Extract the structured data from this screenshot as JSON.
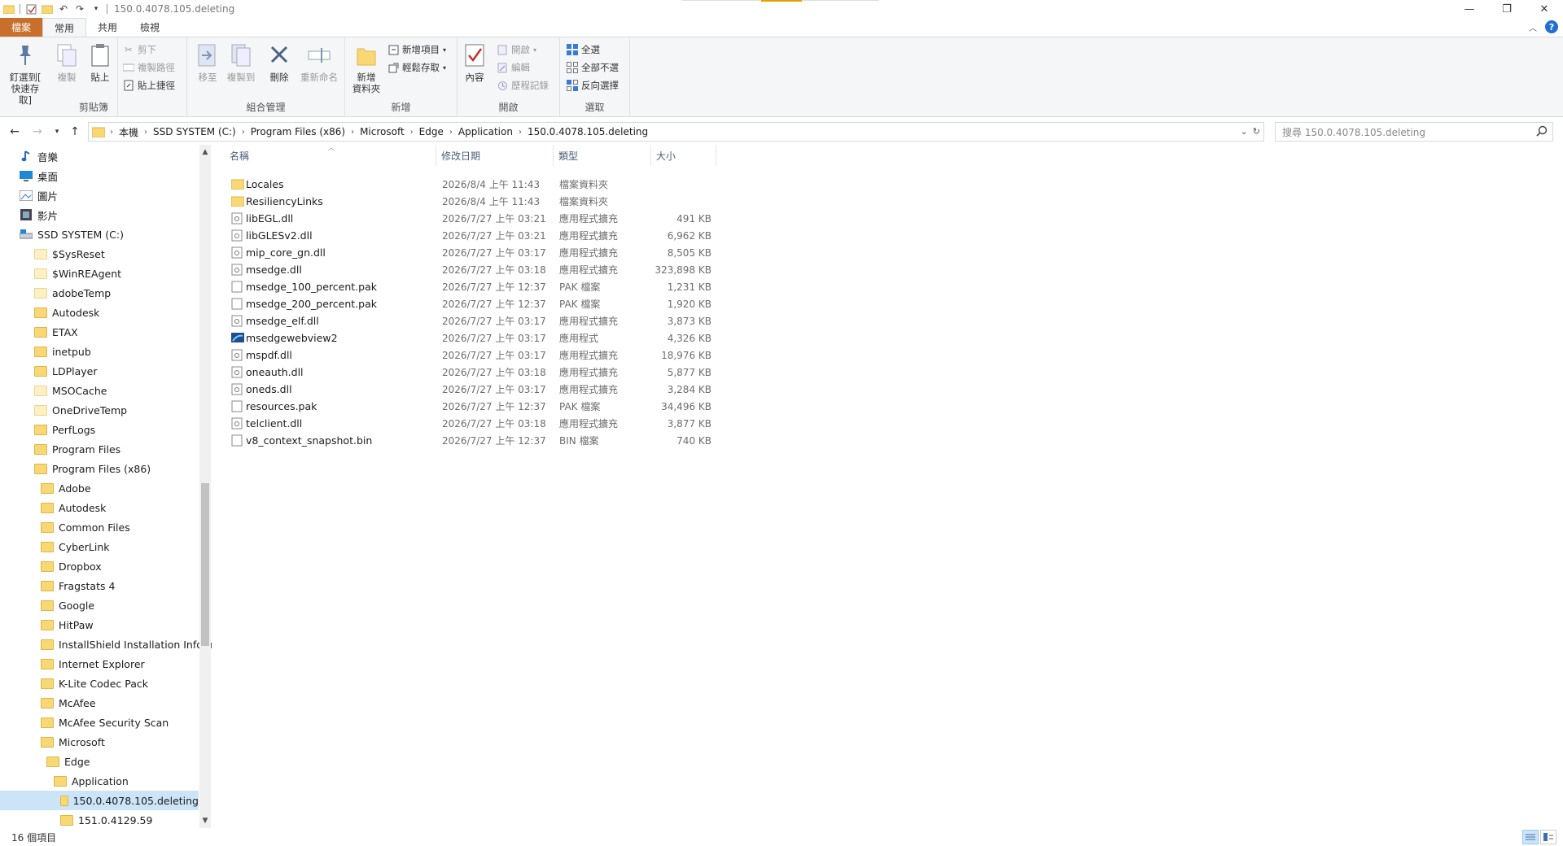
{
  "window": {
    "title": "150.0.4078.105.deleting"
  },
  "ribbon_tabs": [
    "檔案",
    "常用",
    "共用",
    "檢視"
  ],
  "ribbon": {
    "clipboard": {
      "label": "剪貼簿",
      "pin": "釘選到[\n快速存取]",
      "copy": "複製",
      "paste": "貼上",
      "cut": "剪下",
      "copy_path": "複製路徑",
      "paste_shortcut": "貼上捷徑"
    },
    "organize": {
      "label": "組合管理",
      "move_to": "移至",
      "copy_to": "複製到",
      "delete": "刪除",
      "rename": "重新命名"
    },
    "new": {
      "label": "新增",
      "new_folder": "新增\n資料夾",
      "new_item": "新增項目",
      "easy_access": "輕鬆存取"
    },
    "open": {
      "label": "開啟",
      "properties": "內容",
      "open": "開啟",
      "edit": "編輯",
      "history": "歷程記錄"
    },
    "select": {
      "label": "選取",
      "select_all": "全選",
      "select_none": "全部不選",
      "invert": "反向選擇"
    }
  },
  "address": {
    "crumbs": [
      "本機",
      "SSD SYSTEM (C:)",
      "Program Files (x86)",
      "Microsoft",
      "Edge",
      "Application",
      "150.0.4078.105.deleting"
    ],
    "search_placeholder": "搜尋 150.0.4078.105.deleting"
  },
  "nav": {
    "items": [
      {
        "label": "音樂",
        "icon": "music-icon",
        "indent": 0
      },
      {
        "label": "桌面",
        "icon": "desktop-icon",
        "indent": 0
      },
      {
        "label": "圖片",
        "icon": "pictures-icon",
        "indent": 0
      },
      {
        "label": "影片",
        "icon": "videos-icon",
        "indent": 0
      },
      {
        "label": "SSD SYSTEM (C:)",
        "icon": "drive-icon",
        "indent": 0
      },
      {
        "label": "$SysReset",
        "icon": "folder-icon",
        "indent": 1,
        "light": true
      },
      {
        "label": "$WinREAgent",
        "icon": "folder-icon",
        "indent": 1,
        "light": true
      },
      {
        "label": "adobeTemp",
        "icon": "folder-icon",
        "indent": 1,
        "light": true
      },
      {
        "label": "Autodesk",
        "icon": "folder-icon",
        "indent": 1
      },
      {
        "label": "ETAX",
        "icon": "folder-icon",
        "indent": 1
      },
      {
        "label": "inetpub",
        "icon": "folder-icon",
        "indent": 1
      },
      {
        "label": "LDPlayer",
        "icon": "folder-icon",
        "indent": 1
      },
      {
        "label": "MSOCache",
        "icon": "folder-icon",
        "indent": 1,
        "light": true
      },
      {
        "label": "OneDriveTemp",
        "icon": "folder-icon",
        "indent": 1,
        "light": true
      },
      {
        "label": "PerfLogs",
        "icon": "folder-icon",
        "indent": 1
      },
      {
        "label": "Program Files",
        "icon": "folder-icon",
        "indent": 1
      },
      {
        "label": "Program Files (x86)",
        "icon": "folder-icon",
        "indent": 1
      },
      {
        "label": "Adobe",
        "icon": "folder-icon",
        "indent": 2
      },
      {
        "label": "Autodesk",
        "icon": "folder-icon",
        "indent": 2
      },
      {
        "label": "Common Files",
        "icon": "folder-icon",
        "indent": 2
      },
      {
        "label": "CyberLink",
        "icon": "folder-icon",
        "indent": 2
      },
      {
        "label": "Dropbox",
        "icon": "folder-icon",
        "indent": 2
      },
      {
        "label": "Fragstats 4",
        "icon": "folder-icon",
        "indent": 2
      },
      {
        "label": "Google",
        "icon": "folder-icon",
        "indent": 2
      },
      {
        "label": "HitPaw",
        "icon": "folder-icon",
        "indent": 2
      },
      {
        "label": "InstallShield Installation Informa",
        "icon": "folder-icon",
        "indent": 2
      },
      {
        "label": "Internet Explorer",
        "icon": "folder-icon",
        "indent": 2
      },
      {
        "label": "K-Lite Codec Pack",
        "icon": "folder-icon",
        "indent": 2
      },
      {
        "label": "McAfee",
        "icon": "folder-icon",
        "indent": 2
      },
      {
        "label": "McAfee Security Scan",
        "icon": "folder-icon",
        "indent": 2
      },
      {
        "label": "Microsoft",
        "icon": "folder-icon",
        "indent": 2
      },
      {
        "label": "Edge",
        "icon": "folder-icon",
        "indent": 3
      },
      {
        "label": "Application",
        "icon": "folder-icon",
        "indent": 4
      },
      {
        "label": "150.0.4078.105.deleting",
        "icon": "folder-icon",
        "indent": 5,
        "selected": true
      },
      {
        "label": "151.0.4129.59",
        "icon": "folder-icon",
        "indent": 5
      }
    ]
  },
  "columns": {
    "name": "名稱",
    "date": "修改日期",
    "type": "類型",
    "size": "大小"
  },
  "files": [
    {
      "name": "Locales",
      "date": "2026/8/4 上午 11:43",
      "type": "檔案資料夾",
      "size": "",
      "icon": "folder"
    },
    {
      "name": "ResiliencyLinks",
      "date": "2026/8/4 上午 11:43",
      "type": "檔案資料夾",
      "size": "",
      "icon": "folder"
    },
    {
      "name": "libEGL.dll",
      "date": "2026/7/27 上午 03:21",
      "type": "應用程式擴充",
      "size": "491 KB",
      "icon": "dll"
    },
    {
      "name": "libGLESv2.dll",
      "date": "2026/7/27 上午 03:21",
      "type": "應用程式擴充",
      "size": "6,962 KB",
      "icon": "dll"
    },
    {
      "name": "mip_core_gn.dll",
      "date": "2026/7/27 上午 03:17",
      "type": "應用程式擴充",
      "size": "8,505 KB",
      "icon": "dll"
    },
    {
      "name": "msedge.dll",
      "date": "2026/7/27 上午 03:18",
      "type": "應用程式擴充",
      "size": "323,898 KB",
      "icon": "dll"
    },
    {
      "name": "msedge_100_percent.pak",
      "date": "2026/7/27 上午 12:37",
      "type": "PAK 檔案",
      "size": "1,231 KB",
      "icon": "file"
    },
    {
      "name": "msedge_200_percent.pak",
      "date": "2026/7/27 上午 12:37",
      "type": "PAK 檔案",
      "size": "1,920 KB",
      "icon": "file"
    },
    {
      "name": "msedge_elf.dll",
      "date": "2026/7/27 上午 03:17",
      "type": "應用程式擴充",
      "size": "3,873 KB",
      "icon": "dll"
    },
    {
      "name": "msedgewebview2",
      "date": "2026/7/27 上午 03:17",
      "type": "應用程式",
      "size": "4,326 KB",
      "icon": "exe"
    },
    {
      "name": "mspdf.dll",
      "date": "2026/7/27 上午 03:17",
      "type": "應用程式擴充",
      "size": "18,976 KB",
      "icon": "dll"
    },
    {
      "name": "oneauth.dll",
      "date": "2026/7/27 上午 03:18",
      "type": "應用程式擴充",
      "size": "5,877 KB",
      "icon": "dll"
    },
    {
      "name": "oneds.dll",
      "date": "2026/7/27 上午 03:17",
      "type": "應用程式擴充",
      "size": "3,284 KB",
      "icon": "dll"
    },
    {
      "name": "resources.pak",
      "date": "2026/7/27 上午 12:37",
      "type": "PAK 檔案",
      "size": "34,496 KB",
      "icon": "file"
    },
    {
      "name": "telclient.dll",
      "date": "2026/7/27 上午 03:18",
      "type": "應用程式擴充",
      "size": "3,877 KB",
      "icon": "dll"
    },
    {
      "name": "v8_context_snapshot.bin",
      "date": "2026/7/27 上午 12:37",
      "type": "BIN 檔案",
      "size": "740 KB",
      "icon": "file"
    }
  ],
  "status": {
    "count": "16 個項目"
  }
}
